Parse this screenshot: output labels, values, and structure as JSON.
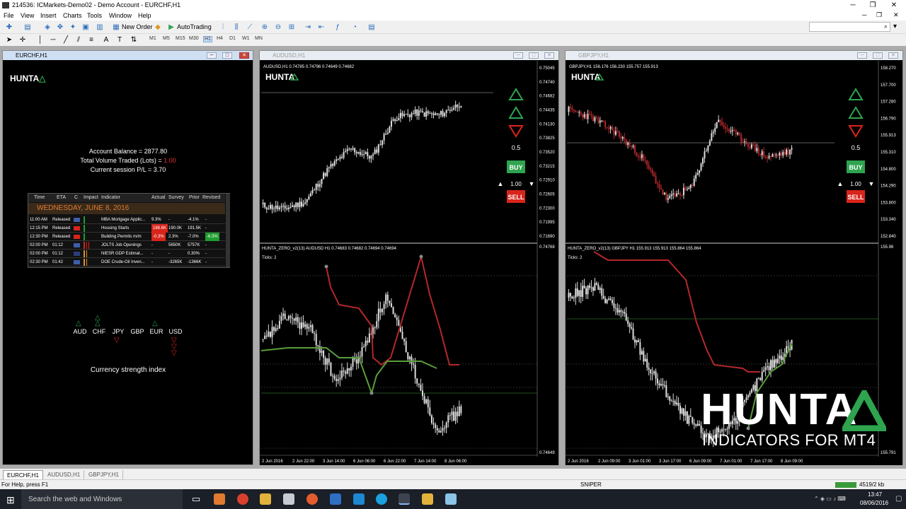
{
  "app": {
    "title": "214536: ICMarkets-Demo02 - Demo Account - EURCHF,H1"
  },
  "menu": [
    "File",
    "View",
    "Insert",
    "Charts",
    "Tools",
    "Window",
    "Help"
  ],
  "toolbar": {
    "new_order": "New Order",
    "autotrading": "AutoTrading",
    "timeframes": [
      "M1",
      "M5",
      "M15",
      "M30",
      "H1",
      "H4",
      "D1",
      "W1",
      "MN"
    ]
  },
  "windows": {
    "eurchf": {
      "title": "EURCHF,H1"
    },
    "audusd": {
      "title": "AUDUSD,H1"
    },
    "gbpjpy": {
      "title": "GBPJPY,H1"
    }
  },
  "brand": {
    "name": "HUNTA",
    "tagline": "INDICATORS FOR MT4",
    "accent": "#2ea44f"
  },
  "account": {
    "balance_label": "Account Balance = 2877.80",
    "volume_label": "Total Volume Traded (Lots) = ",
    "volume_value": "1.00",
    "pl_label": "Current session P/L = 3.70"
  },
  "calendar": {
    "headers": [
      "Time",
      "ETA",
      "C",
      "Impact",
      "Indicator",
      "Actual",
      "Survey",
      "Prior",
      "Revised"
    ],
    "date": "WEDNESDAY, JUNE 8, 2016",
    "rows": [
      {
        "time": "11:00 AM",
        "eta": "Released",
        "flag": "US",
        "impact": 1,
        "indicator": "MBA Mortgage Applic...",
        "actual": "9.3%",
        "survey": "-",
        "prior": "-4.1%",
        "revised": "-",
        "actual_bg": ""
      },
      {
        "time": "12:15 PM",
        "eta": "Released",
        "flag": "CA",
        "impact": 1,
        "indicator": "Housing Starts",
        "actual": "188.6K",
        "survey": "190.0K",
        "prior": "191.5K",
        "revised": "-",
        "actual_bg": "#d9241b"
      },
      {
        "time": "12:30 PM",
        "eta": "Released",
        "flag": "CA",
        "impact": 1,
        "indicator": "Building Permits m/m",
        "actual": "-0.3%",
        "survey": "2.3%",
        "prior": "-7.0%",
        "revised": "-6.3%",
        "actual_bg": "#d9241b",
        "revised_bg": "#1e9e2e"
      },
      {
        "time": "02:00 PM",
        "eta": "01:12",
        "flag": "US",
        "impact": 3,
        "indicator": "JOLTS Job Openings",
        "actual": "-",
        "survey": "5650K",
        "prior": "5757K",
        "revised": "-"
      },
      {
        "time": "02:00 PM",
        "eta": "01:12",
        "flag": "UK",
        "impact": 2,
        "indicator": "NIESR GDP Estimat...",
        "actual": "-",
        "survey": "-",
        "prior": "0.30%",
        "revised": "-"
      },
      {
        "time": "02:30 PM",
        "eta": "01:42",
        "flag": "US",
        "impact": 2,
        "indicator": "DOE Crude-Oil Inven...",
        "actual": "-",
        "survey": "-3265K",
        "prior": "-1366K",
        "revised": "-"
      }
    ]
  },
  "strength": {
    "currencies": [
      "AUD",
      "CHF",
      "JPY",
      "GBP",
      "EUR",
      "USD"
    ],
    "up": [
      1,
      2,
      0,
      0,
      1,
      0
    ],
    "down": [
      0,
      0,
      1,
      0,
      0,
      3
    ],
    "label": "Currency strength index"
  },
  "audusd": {
    "header": "AUDUSD,H1  0.74785 0.74796 0.74649 0.74682",
    "indicator_header": "HUNTA_ZERO_v2(13) AUDUSD H1 0.74683 0.74682 0.74694 0.74694",
    "ticks": "Ticks: 2",
    "lot_step": "0.5",
    "lots": "1.00",
    "buy": "BUY",
    "sell": "SELL",
    "price_labels": [
      "0.75045",
      "0.74740",
      "0.74682",
      "0.74435",
      "0.74130",
      "0.73825",
      "0.73520",
      "0.73215",
      "0.72910",
      "0.72605",
      "0.72300",
      "0.71995",
      "0.71690"
    ],
    "ind_labels": [
      "0.74768",
      "0.74649"
    ],
    "time_labels": [
      "2 Jun 2016",
      "2 Jun 22:00",
      "3 Jun 14:00",
      "6 Jun 06:00",
      "6 Jun 22:00",
      "7 Jun 14:00",
      "8 Jun 06:00"
    ]
  },
  "gbpjpy": {
    "header": "GBPJPY,H1  156.176 156.230 155.757 155.913",
    "indicator_header": "HUNTA_ZERO_v2(13) GBPJPY H1 155.913 155.913 155.864 155.864",
    "ticks": "Ticks: 2",
    "lot_step": "0.5",
    "lots": "1.00",
    "buy": "BUY",
    "sell": "SELL",
    "price_labels": [
      "158.270",
      "157.700",
      "157.280",
      "156.790",
      "155.913",
      "155.310",
      "154.800",
      "154.290",
      "153.800",
      "153.340",
      "152.840"
    ],
    "ind_labels": [
      "155.96",
      "155.791"
    ],
    "time_labels": [
      "2 Jun 2016",
      "2 Jun 09:00",
      "3 Jun 01:00",
      "3 Jun 17:00",
      "6 Jun 09:00",
      "7 Jun 01:00",
      "7 Jun 17:00",
      "8 Jun 09:00"
    ]
  },
  "tabs": [
    "EURCHF,H1",
    "AUDUSD,H1",
    "GBPJPY,H1"
  ],
  "status": {
    "help": "For Help, press F1",
    "profile": "SNIPER",
    "traffic": "4519/2 kb"
  },
  "taskbar": {
    "search": "Search the web and Windows",
    "time": "13:47",
    "date": "08/06/2016"
  }
}
